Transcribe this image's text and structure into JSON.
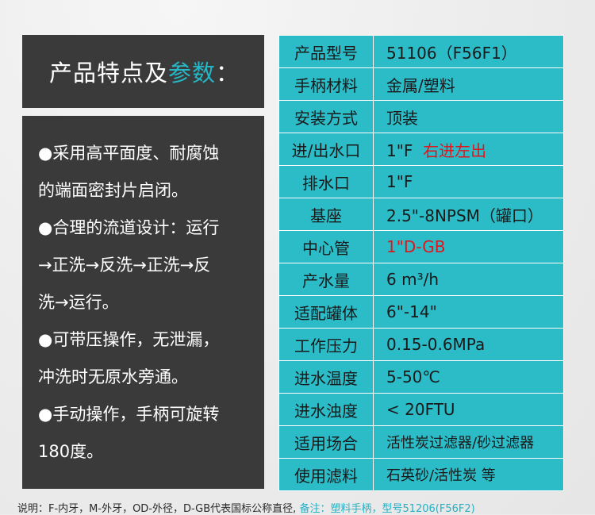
{
  "title": {
    "main": "产品特点及",
    "highlight": "参数",
    "colon": "："
  },
  "features": [
    "●采用高平面度、耐腐蚀",
    "的端面密封片启闭。",
    "●合理的流道设计：运行",
    "→正洗→反洗→正洗→反",
    "洗→运行。",
    "●可带压操作，无泄漏，",
    "冲洗时无原水旁通。",
    "●手动操作，手柄可旋转",
    "180度。"
  ],
  "specs": [
    {
      "label": "产品型号",
      "value": "51106（F56F1）",
      "extra": ""
    },
    {
      "label": "手柄材料",
      "value": "金属/塑料",
      "extra": ""
    },
    {
      "label": "安装方式",
      "value": "顶装",
      "extra": ""
    },
    {
      "label": "进/出水口",
      "value": "1\"F",
      "extra": "右进左出"
    },
    {
      "label": "排水口",
      "value": "1\"F",
      "extra": ""
    },
    {
      "label": "基座",
      "value": "2.5\"-8NPSM（罐口）",
      "extra": ""
    },
    {
      "label": "中心管",
      "value": "",
      "extra": "1\"D-GB"
    },
    {
      "label": "产水量",
      "value": "6 m³/h",
      "extra": ""
    },
    {
      "label": "适配罐体",
      "value": "6\"-14\"",
      "extra": ""
    },
    {
      "label": "工作压力",
      "value": "0.15-0.6MPa",
      "extra": ""
    },
    {
      "label": "进水温度",
      "value": "5-50℃",
      "extra": ""
    },
    {
      "label": "进水浊度",
      "value": "< 20FTU",
      "extra": ""
    },
    {
      "label": "适用场合",
      "value": "活性炭过滤器/砂过滤器",
      "extra": ""
    },
    {
      "label": "使用滤料",
      "value": "石英砂/活性炭 等",
      "extra": ""
    }
  ],
  "footer": {
    "text": "说明：F-内牙，M-外牙，OD-外径，D-GB代表国标公称直径,",
    "note": "备注：塑料手柄，型号51206(F56F2)"
  },
  "colors": {
    "accent": "#26b7c7",
    "table_bg": "#2bbcc8",
    "panel_bg": "#3a3a3a",
    "red": "#e0161c"
  }
}
